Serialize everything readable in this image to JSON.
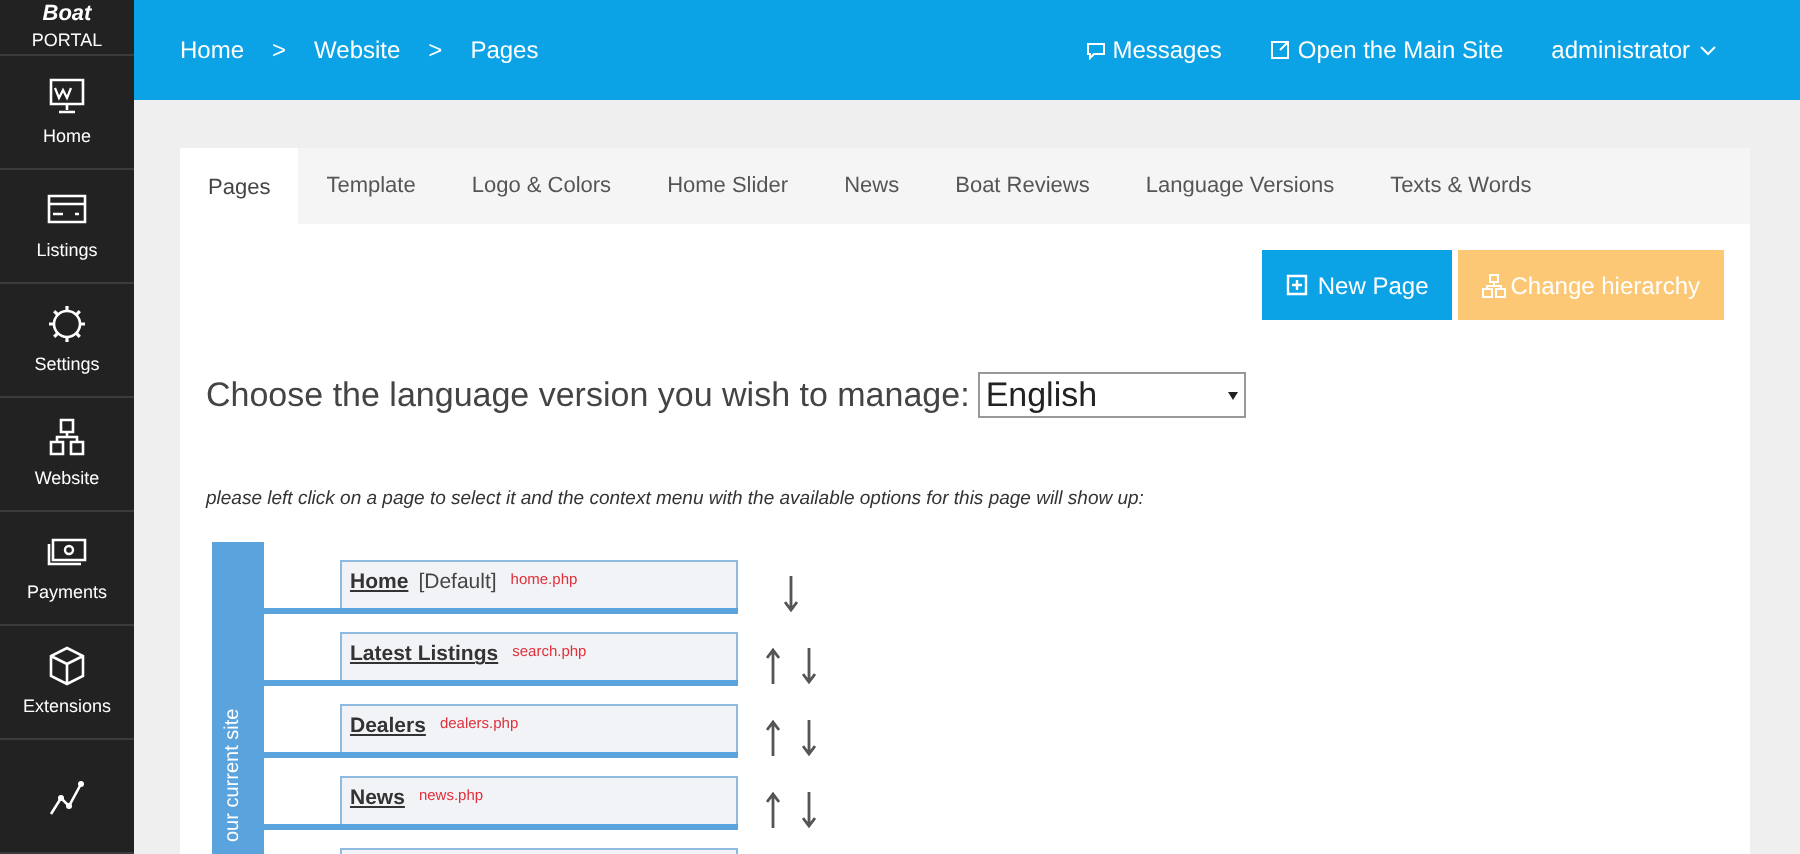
{
  "brand": {
    "title": "Boat",
    "subtitle": "PORTAL"
  },
  "sidebar": {
    "items": [
      {
        "label": "Home"
      },
      {
        "label": "Listings"
      },
      {
        "label": "Settings"
      },
      {
        "label": "Website"
      },
      {
        "label": "Payments"
      },
      {
        "label": "Extensions"
      }
    ]
  },
  "breadcrumb": [
    "Home",
    "Website",
    "Pages"
  ],
  "breadcrumb_separator": ">",
  "topbar": {
    "messages": "Messages",
    "open_site": "Open the Main Site",
    "user": "administrator"
  },
  "tabs": [
    {
      "label": "Pages",
      "selected": true
    },
    {
      "label": "Template",
      "selected": false
    },
    {
      "label": "Logo & Colors",
      "selected": false
    },
    {
      "label": "Home Slider",
      "selected": false
    },
    {
      "label": "News",
      "selected": false
    },
    {
      "label": "Boat Reviews",
      "selected": false
    },
    {
      "label": "Language Versions",
      "selected": false
    },
    {
      "label": "Texts & Words",
      "selected": false
    }
  ],
  "buttons": {
    "new_page": "New Page",
    "change_hierarchy": "Change hierarchy"
  },
  "language": {
    "prompt": "Choose the language version you wish to manage:",
    "value": "English"
  },
  "hint": "please left click on a page to select it and the context menu with the available options for this page will show up:",
  "tree": {
    "root_label": "our current site",
    "pages": [
      {
        "name": "Home",
        "note": "[Default]",
        "file": "home.php",
        "up": false,
        "down": true
      },
      {
        "name": "Latest Listings",
        "file": "search.php",
        "up": true,
        "down": true
      },
      {
        "name": "Dealers",
        "file": "dealers.php",
        "up": true,
        "down": true
      },
      {
        "name": "News",
        "file": "news.php",
        "up": true,
        "down": true
      }
    ]
  }
}
